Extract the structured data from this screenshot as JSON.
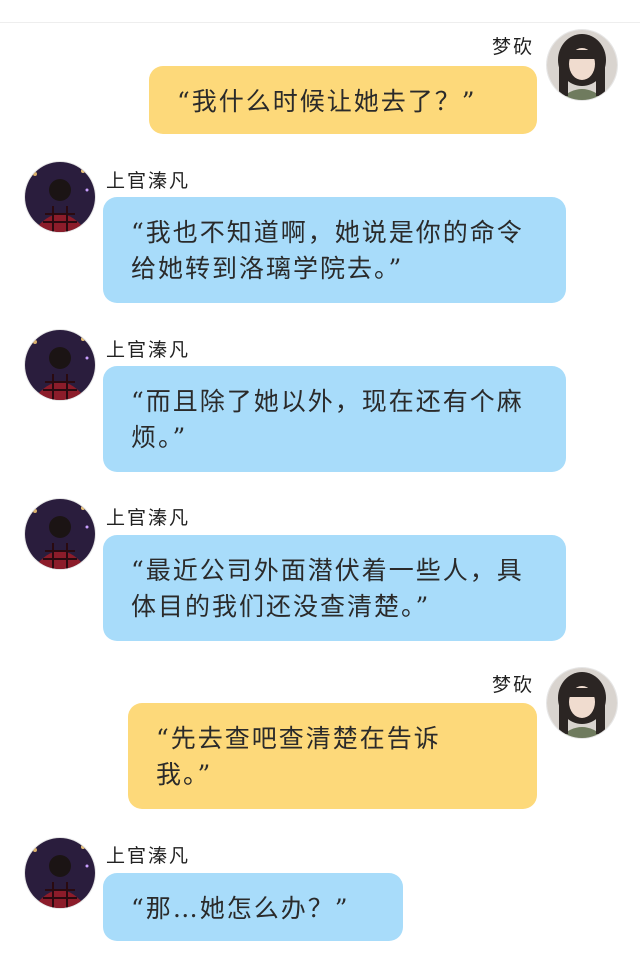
{
  "conversation": {
    "messages": [
      {
        "sender": "梦砍",
        "side": "right",
        "color": "#fdd97a",
        "text": "“我什么时候让她去了？”"
      },
      {
        "sender": "上官溱凡",
        "side": "left",
        "color": "#a8dcfa",
        "text": "“我也不知道啊，她说是你的命令给她转到洛璃学院去。”"
      },
      {
        "sender": "上官溱凡",
        "side": "left",
        "color": "#a8dcfa",
        "text": "“而且除了她以外，现在还有个麻烦。”"
      },
      {
        "sender": "上官溱凡",
        "side": "left",
        "color": "#a8dcfa",
        "text": "“最近公司外面潜伏着一些人，具体目的我们还没查清楚。”"
      },
      {
        "sender": "梦砍",
        "side": "right",
        "color": "#fdd97a",
        "text": "“先去查吧查清楚在告诉我。”"
      },
      {
        "sender": "上官溱凡",
        "side": "left",
        "color": "#a8dcfa",
        "text": "“那…她怎么办？”"
      }
    ]
  }
}
